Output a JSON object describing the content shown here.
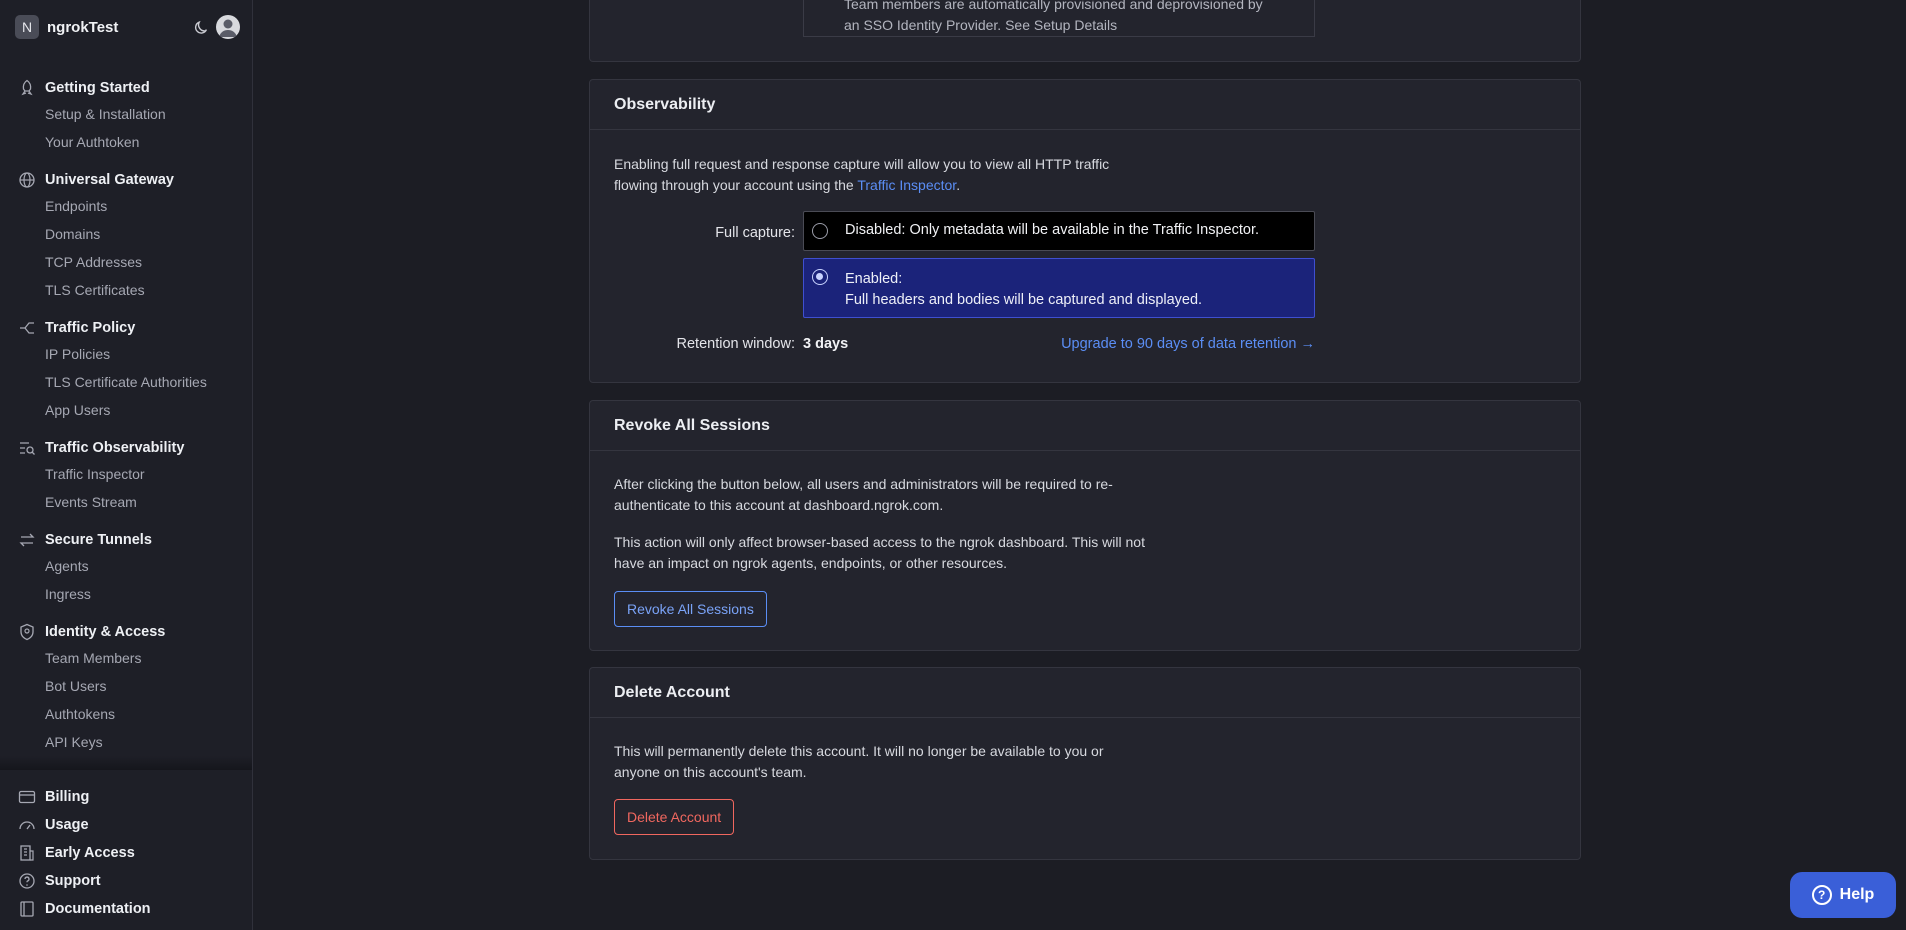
{
  "org": {
    "initial": "N",
    "name": "ngrokTest"
  },
  "nav": {
    "getting_started": {
      "title": "Getting Started",
      "items": [
        "Setup & Installation",
        "Your Authtoken"
      ]
    },
    "universal_gateway": {
      "title": "Universal Gateway",
      "items": [
        "Endpoints",
        "Domains",
        "TCP Addresses",
        "TLS Certificates"
      ]
    },
    "traffic_policy": {
      "title": "Traffic Policy",
      "items": [
        "IP Policies",
        "TLS Certificate Authorities",
        "App Users"
      ]
    },
    "traffic_observability": {
      "title": "Traffic Observability",
      "items": [
        "Traffic Inspector",
        "Events Stream"
      ]
    },
    "secure_tunnels": {
      "title": "Secure Tunnels",
      "items": [
        "Agents",
        "Ingress"
      ]
    },
    "identity_access": {
      "title": "Identity & Access",
      "items": [
        "Team Members",
        "Bot Users",
        "Authtokens",
        "API Keys"
      ]
    }
  },
  "bottom_nav": [
    "Billing",
    "Usage",
    "Early Access",
    "Support",
    "Documentation"
  ],
  "sso_card": {
    "text_line1": "Team members are automatically provisioned and deprovisioned by",
    "text_line2": "an SSO Identity Provider. See Setup Details"
  },
  "observability": {
    "title": "Observability",
    "intro_line1": "Enabling full request and response capture will allow you to view all HTTP traffic",
    "intro_line2_prefix": "flowing through your account using the ",
    "intro_link": "Traffic Inspector",
    "intro_suffix": ".",
    "full_capture_label": "Full capture:",
    "option_disabled": "Disabled: Only metadata will be available in the Traffic Inspector.",
    "option_enabled_title": "Enabled:",
    "option_enabled_desc": "Full headers and bodies will be captured and displayed.",
    "retention_label": "Retention window:",
    "retention_value": "3 days",
    "upgrade_link": "Upgrade to 90 days of data retention →"
  },
  "revoke": {
    "title": "Revoke All Sessions",
    "p1_line1": "After clicking the button below, all users and administrators will be required to re-",
    "p1_line2": "authenticate to this account at dashboard.ngrok.com.",
    "p2_line1": "This action will only affect browser-based access to the ngrok dashboard. This will not",
    "p2_line2": "have an impact on ngrok agents, endpoints, or other resources.",
    "button": "Revoke All Sessions"
  },
  "delete": {
    "title": "Delete Account",
    "p_line1": "This will permanently delete this account. It will no longer be available to you or",
    "p_line2": "anyone on this account's team.",
    "button": "Delete Account"
  },
  "help": {
    "label": "Help",
    "icon": "?"
  },
  "colors": {
    "accent": "#5b8ef5",
    "danger": "#f0675f",
    "selected_bg": "#1b237a",
    "help_bg": "#3a5fd8"
  }
}
